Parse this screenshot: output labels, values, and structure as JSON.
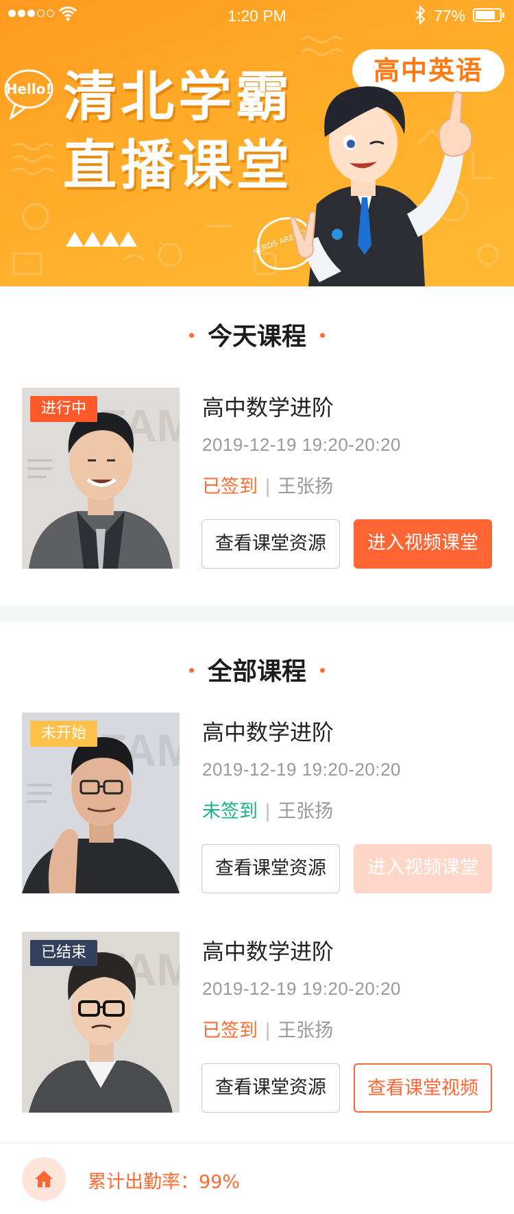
{
  "status_bar": {
    "time": "1:20 PM",
    "battery": "77%"
  },
  "banner": {
    "hello": "Hello!",
    "title_line1": "清北学霸",
    "title_line2": "直播课堂",
    "subject": "高中英语",
    "badge_text": "NERDS ARE COOL"
  },
  "today": {
    "title": "今天课程",
    "courses": [
      {
        "badge": "进行中",
        "name": "高中数学进阶",
        "time": "2019-12-19 19:20-20:20",
        "status": "已签到",
        "teacher": "王张扬",
        "btn_left": "查看课堂资源",
        "btn_right": "进入视频课堂"
      }
    ]
  },
  "all": {
    "title": "全部课程",
    "courses": [
      {
        "badge": "未开始",
        "name": "高中数学进阶",
        "time": "2019-12-19 19:20-20:20",
        "status": "未签到",
        "teacher": "王张扬",
        "btn_left": "查看课堂资源",
        "btn_right": "进入视频课堂"
      },
      {
        "badge": "已结束",
        "name": "高中数学进阶",
        "time": "2019-12-19 19:20-20:20",
        "status": "已签到",
        "teacher": "王张扬",
        "btn_left": "查看课堂资源",
        "btn_right": "查看课堂视频"
      }
    ]
  },
  "footer": {
    "attendance": "累计出勤率：99%"
  },
  "thumb_watermark": "FAMOUS",
  "icons": [
    "signal-icon",
    "wifi-icon",
    "bluetooth-icon",
    "battery-icon",
    "home-icon"
  ],
  "colors": {
    "brand_orange": "#ff6634",
    "banner_orange": "#ff9a1f",
    "signed": "#ff6a33",
    "unsigned": "#17b287",
    "ended_badge": "#33415c",
    "upcoming_badge": "#ffc14a"
  }
}
